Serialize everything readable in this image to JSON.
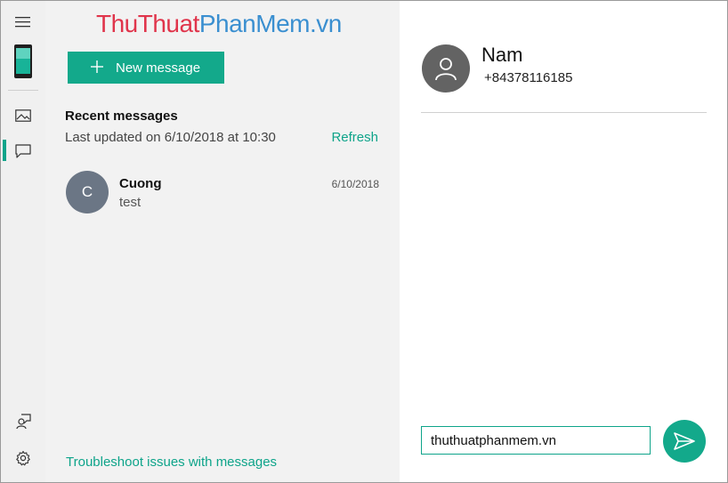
{
  "watermark": {
    "thu": "Thu",
    "thuat": "Thuat",
    "phan": "Phan",
    "mem": "Mem",
    "dotvn": ".vn",
    "colors": {
      "red": "#e0344b",
      "blue": "#3a8fd0"
    }
  },
  "rail": {
    "items": [
      {
        "icon": "hamburger-menu-icon"
      },
      {
        "icon": "phone-icon"
      },
      {
        "icon": "photos-icon"
      },
      {
        "icon": "messages-icon",
        "active": true
      },
      {
        "icon": "feedback-icon"
      },
      {
        "icon": "gear-icon"
      }
    ]
  },
  "list": {
    "new_message_label": "New message",
    "recent_title": "Recent messages",
    "last_updated": "Last updated on 6/10/2018 at 10:30",
    "refresh_label": "Refresh",
    "conversations": [
      {
        "initial": "C",
        "name": "Cuong",
        "snippet": "test",
        "date": "6/10/2018"
      }
    ],
    "troubleshoot_label": "Troubleshoot issues with messages"
  },
  "conversation": {
    "contact_name": "Nam",
    "contact_number": "+84378116185",
    "compose_value": "thuthuatphanmem.vn"
  },
  "colors": {
    "accent": "#13a98b",
    "link": "#0ea48a",
    "avatar_contact": "#636363",
    "avatar_conv": "#6b7685",
    "pane_bg": "#f2f2f2"
  }
}
